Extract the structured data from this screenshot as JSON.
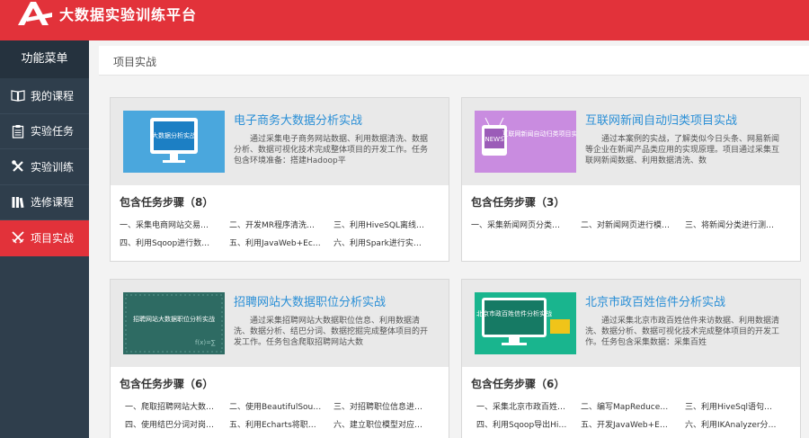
{
  "header": {
    "title": "大数据实验训练平台"
  },
  "sidebar": {
    "title": "功能菜单",
    "items": [
      {
        "label": "我的课程",
        "icon": "book-icon"
      },
      {
        "label": "实验任务",
        "icon": "clipboard-icon"
      },
      {
        "label": "实验训练",
        "icon": "tools-icon"
      },
      {
        "label": "选修课程",
        "icon": "books-icon"
      },
      {
        "label": "项目实战",
        "icon": "swords-icon",
        "active": true
      }
    ]
  },
  "breadcrumb": "项目实战",
  "cards": [
    {
      "title": "电子商务大数据分析实战",
      "desc": "通过采集电子商务网站数据、利用数据清洗、数据分析、数据可视化技术完成整体项目的开发工作。任务包含环境准备：搭建Hadoop平",
      "steps_label": "包含任务步骤（8）",
      "thumb_text": "大数据分析实战",
      "steps": [
        "一、采集电商网站交易…",
        "二、开发MR程序清洗…",
        "三、利用HiveSQL离线…",
        "四、利用Sqoop进行数…",
        "五、利用JavaWeb+Ec…",
        "六、利用Spark进行实…"
      ]
    },
    {
      "title": "互联网新闻自动归类项目实战",
      "desc": "通过本案例的实战，了解类似今日头条、网易新闻等企业在新闻产品类应用的实现原理。项目通过采集互联网新闻数据、利用数据清洗、数",
      "steps_label": "包含任务步骤（3）",
      "thumb_text": "互联网新闻自动归类项目实战",
      "steps": [
        "一、采集新闻网页分类…",
        "二、对新闻网页进行模…",
        "三、将新闻分类进行测…"
      ]
    },
    {
      "title": "招聘网站大数据职位分析实战",
      "desc": "通过采集招聘网站大数据职位信息、利用数据清洗、数据分析、结巴分词、数据挖掘完成整体项目的开发工作。任务包含爬取招聘网站大数",
      "steps_label": "包含任务步骤（6）",
      "thumb_text": "招聘网站大数据职位分析实战",
      "steps": [
        "一、爬取招聘网站大数…",
        "二、使用BeautifulSou…",
        "三、对招聘职位信息进…",
        "四、使用结巴分词对岗…",
        "五、利用Echarts将职…",
        "六、建立职位模型对应…"
      ]
    },
    {
      "title": "北京市政百姓信件分析实战",
      "desc": "通过采集北京市政百姓信件来访数据、利用数据清洗、数据分析、数据可视化技术完成整体项目的开发工作。任务包含采集数据：采集百姓",
      "steps_label": "包含任务步骤（6）",
      "thumb_text": "北京市政百姓信件分析实战",
      "steps": [
        "一、采集北京市政百姓…",
        "二、编写MapReduce…",
        "三、利用HiveSql语句…",
        "四、利用Sqoop导出Hi…",
        "五、开发JavaWeb+E…",
        "六、利用IKAnalyzer分…"
      ]
    }
  ]
}
